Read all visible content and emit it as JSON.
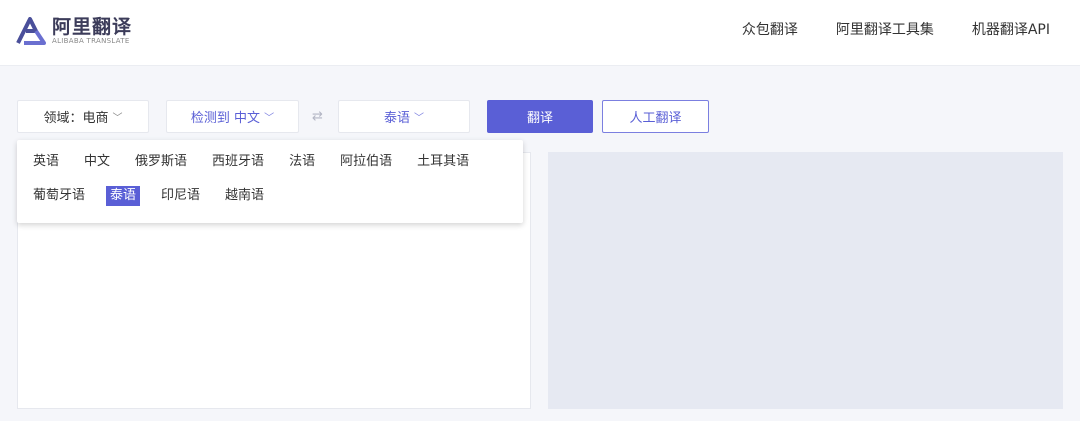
{
  "header": {
    "logo_title": "阿里翻译",
    "logo_subtitle": "ALIBABA TRANSLATE",
    "nav": [
      "众包翻译",
      "阿里翻译工具集",
      "机器翻译API"
    ]
  },
  "toolbar": {
    "domain_label": "领域：电商",
    "source_label": "检测到 中文",
    "swap_symbol": "⇄",
    "target_label": "泰语",
    "translate_button": "翻译",
    "human_button": "人工翻译",
    "chevron": "﹀"
  },
  "dropdown": {
    "row1": [
      "英语",
      "中文",
      "俄罗斯语",
      "西班牙语",
      "法语",
      "阿拉伯语",
      "土耳其语"
    ],
    "row2": [
      "葡萄牙语",
      "泰语",
      "印尼语",
      "越南语"
    ],
    "selected": "泰语"
  },
  "colors": {
    "accent": "#5a5fd6",
    "background": "#f5f6fa",
    "output_panel": "#e6e9f2"
  }
}
